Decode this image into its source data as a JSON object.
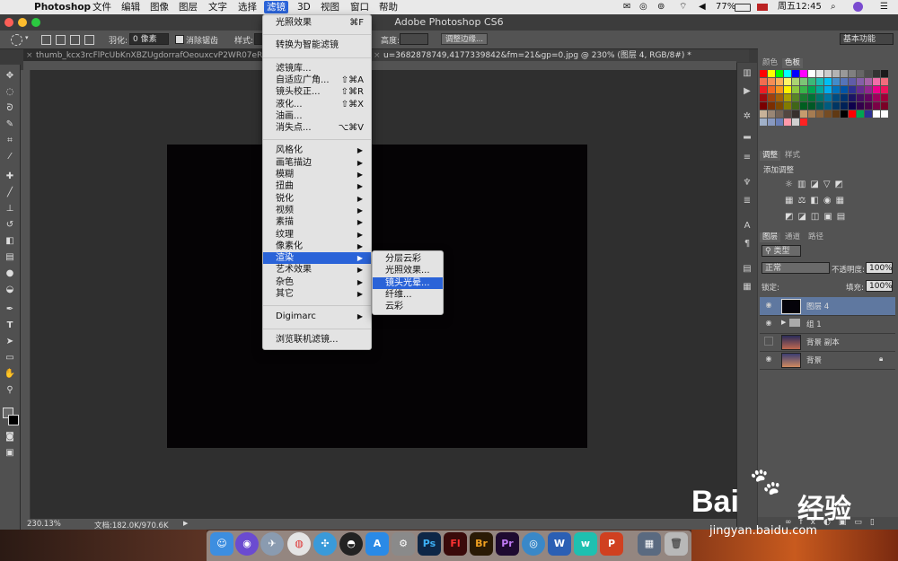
{
  "menubar": {
    "apple": "",
    "items": [
      "Photoshop",
      "文件",
      "编辑",
      "图像",
      "图层",
      "文字",
      "选择",
      "滤镜",
      "3D",
      "视图",
      "窗口",
      "帮助"
    ],
    "active": "滤镜",
    "status": {
      "battery": "77%",
      "clock": "周五12:45"
    }
  },
  "window": {
    "title": "Adobe Photoshop CS6"
  },
  "options": {
    "feather_label": "羽化:",
    "feather_value": "0 像素",
    "antialias_label": "消除锯齿",
    "style_label": "样式:",
    "height_label": "高度:",
    "refine_edge": "调整边缘...",
    "workspace": "基本功能"
  },
  "tabs": [
    {
      "label": "thumb_kcx3rcFlPcUbKnXBZUgdorrafOeouxcvP2WR07eRxtA.jpg"
    },
    {
      "label": "u=3682878749,4177339842&fm=21&gp=0.jpg @ 230% (图层 4, RGB/8#) *"
    }
  ],
  "status": {
    "zoom": "230.13%",
    "doc": "文档:182.0K/970.6K"
  },
  "filter_menu": [
    {
      "label": "光照效果",
      "shortcut": "⌘F"
    },
    {
      "sep": true
    },
    {
      "label": "转换为智能滤镜"
    },
    {
      "sep": true
    },
    {
      "label": "滤镜库..."
    },
    {
      "label": "自适应广角...",
      "shortcut": "⇧⌘A"
    },
    {
      "label": "镜头校正...",
      "shortcut": "⇧⌘R"
    },
    {
      "label": "液化...",
      "shortcut": "⇧⌘X"
    },
    {
      "label": "油画..."
    },
    {
      "label": "消失点...",
      "shortcut": "⌥⌘V"
    },
    {
      "sep": true
    },
    {
      "label": "风格化",
      "sub": true
    },
    {
      "label": "画笔描边",
      "sub": true
    },
    {
      "label": "模糊",
      "sub": true
    },
    {
      "label": "扭曲",
      "sub": true
    },
    {
      "label": "锐化",
      "sub": true
    },
    {
      "label": "视频",
      "sub": true
    },
    {
      "label": "素描",
      "sub": true
    },
    {
      "label": "纹理",
      "sub": true
    },
    {
      "label": "像素化",
      "sub": true
    },
    {
      "label": "渲染",
      "sub": true,
      "highlight": true
    },
    {
      "label": "艺术效果",
      "sub": true
    },
    {
      "label": "杂色",
      "sub": true
    },
    {
      "label": "其它",
      "sub": true
    },
    {
      "sep": true
    },
    {
      "label": "Digimarc",
      "sub": true
    },
    {
      "sep": true
    },
    {
      "label": "浏览联机滤镜..."
    }
  ],
  "render_submenu": [
    {
      "label": "分层云彩"
    },
    {
      "label": "光照效果..."
    },
    {
      "label": "镜头光晕...",
      "highlight": true
    },
    {
      "label": "纤维..."
    },
    {
      "label": "云彩"
    }
  ],
  "panels": {
    "color_tabs": [
      "颜色",
      "色板"
    ],
    "adjust_tabs": [
      "调整",
      "样式"
    ],
    "adjust_title": "添加调整",
    "layer_tabs": [
      "图层",
      "通道",
      "路径"
    ],
    "kind": "类型",
    "blend": "正常",
    "opacity_label": "不透明度:",
    "opacity": "100%",
    "lock_label": "锁定:",
    "fill_label": "填充:",
    "fill": "100%",
    "layers": [
      {
        "name": "图层 4",
        "selected": true
      },
      {
        "name": "组 1",
        "group": true
      },
      {
        "name": "背景 副本",
        "hidden": true
      },
      {
        "name": "背景",
        "locked": true
      }
    ]
  },
  "watermark": {
    "brand": "Bai",
    "brand2": "经验",
    "url": "jingyan.baidu.com"
  }
}
